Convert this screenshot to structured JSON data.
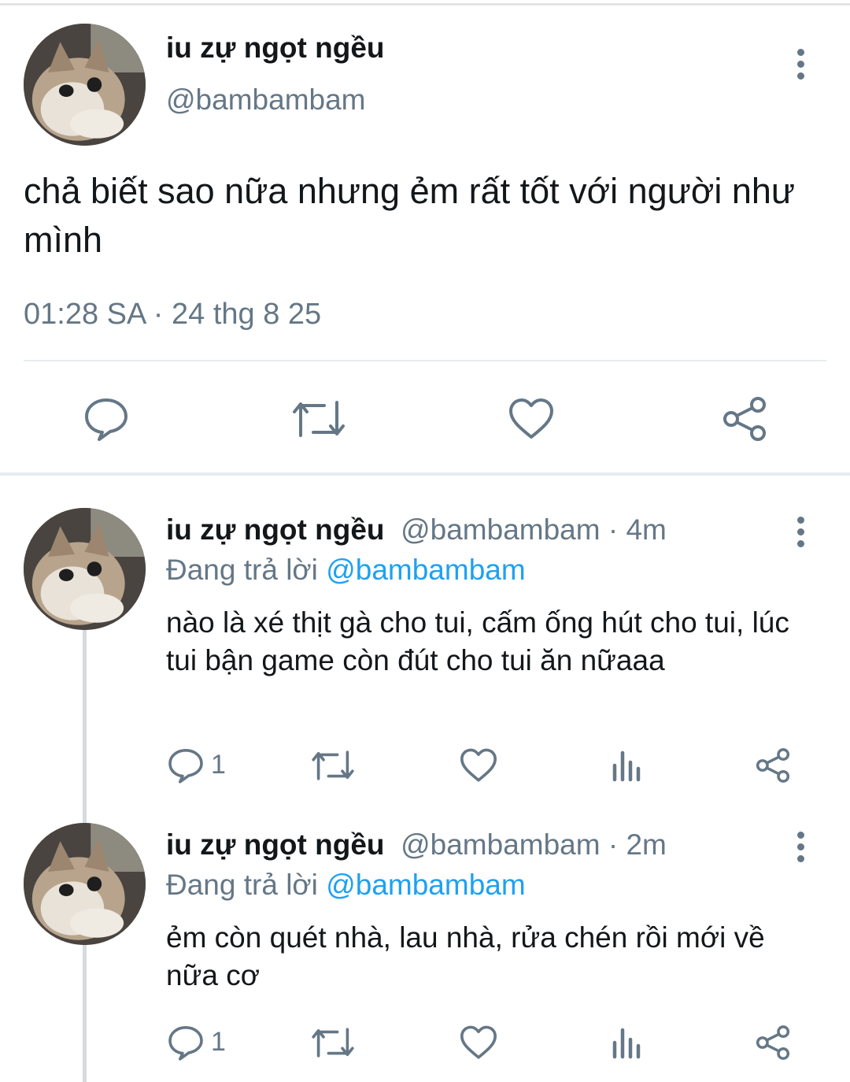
{
  "tweet": {
    "name": "iu zự ngọt ngều",
    "handle": "@bambambam",
    "text": "chả biết sao nữa nhưng ẻm rất tốt với người như mình",
    "timestamp": "01:28 SA · 24 thg 8 25",
    "actions": [
      "reply-icon",
      "retweet-icon",
      "like-icon",
      "share-icon"
    ]
  },
  "replies": [
    {
      "name": "iu zự ngọt ngều",
      "meta": "@bambambam · 4m",
      "replying_prefix": "Đang trả lời",
      "replying_mention": "@bambambam",
      "text": "nào là xé thịt gà cho tui, cấm ống hút cho tui, lúc tui bận game còn đút cho tui ăn nữaaa",
      "reply_count": "1"
    },
    {
      "name": "iu zự ngọt ngều",
      "meta": "@bambambam · 2m",
      "replying_prefix": "Đang trả lời",
      "replying_mention": "@bambambam",
      "text": "ẻm còn quét nhà, lau nhà, rửa chén rồi mới về nữa cơ",
      "reply_count": "1"
    }
  ],
  "colors": {
    "muted": "#657786",
    "link": "#1da1f2",
    "divider": "#e6ecf0"
  }
}
